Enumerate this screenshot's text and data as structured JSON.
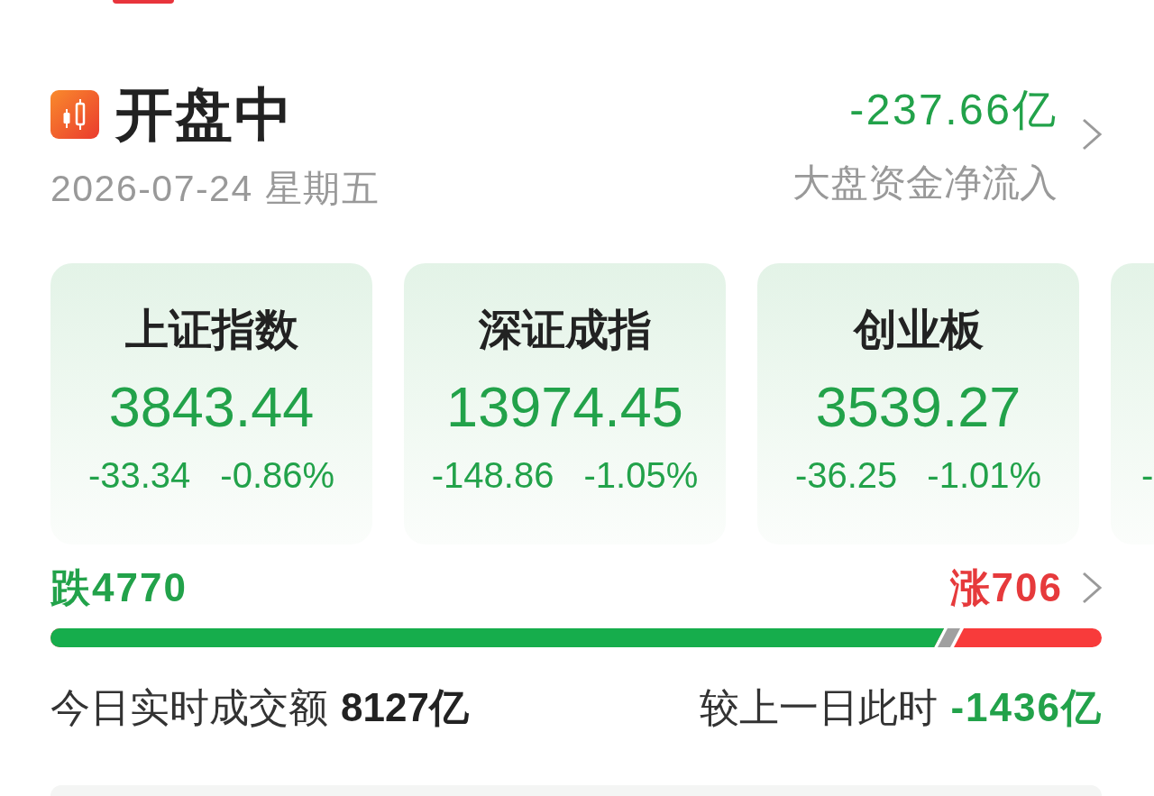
{
  "status": {
    "title": "开盘中",
    "date": "2026-07-24 星期五"
  },
  "net_inflow": {
    "amount": "-237.66亿",
    "falling": true,
    "label": "大盘资金净流入"
  },
  "indices": [
    {
      "name": "上证指数",
      "value": "3843.44",
      "change": "-33.34",
      "change_pct": "-0.86%",
      "falling": true
    },
    {
      "name": "深证成指",
      "value": "13974.45",
      "change": "-148.86",
      "change_pct": "-1.05%",
      "falling": true
    },
    {
      "name": "创业板",
      "value": "3539.27",
      "change": "-36.25",
      "change_pct": "-1.01%",
      "falling": true
    },
    {
      "change": "-",
      "falling": true
    }
  ],
  "breadth": {
    "decliners": "跌4770",
    "advancers": "涨706",
    "level": 0.85
  },
  "turnover": {
    "label": "今日实时成交额",
    "amount": "8127亿",
    "compare_label": "较上一日此时",
    "compare_amount": "-1436亿",
    "compare_falling": true
  }
}
